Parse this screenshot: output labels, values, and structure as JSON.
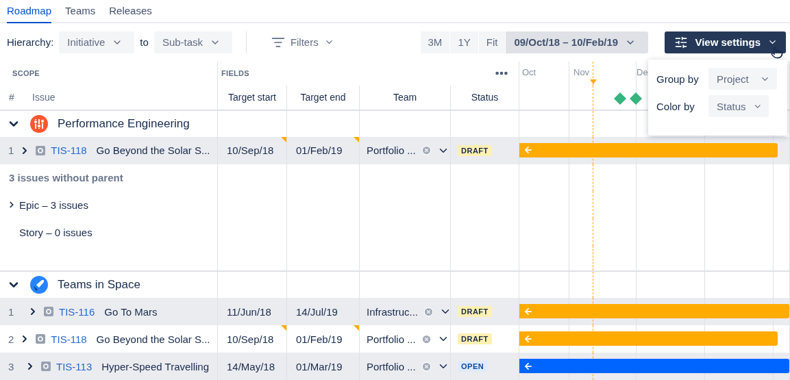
{
  "tabs": [
    {
      "label": "Roadmap",
      "selected": true
    },
    {
      "label": "Teams",
      "selected": false
    },
    {
      "label": "Releases",
      "selected": false
    }
  ],
  "toolbar": {
    "hierarchy_label": "Hierarchy:",
    "hierarchy_from": "Initiative",
    "to_label": "to",
    "hierarchy_to": "Sub-task",
    "filters": "Filters",
    "ranges": [
      {
        "label": "3M",
        "selected": false
      },
      {
        "label": "1Y",
        "selected": false
      },
      {
        "label": "Fit",
        "selected": false
      }
    ],
    "date_range": "09/Oct/18 – 10/Feb/19",
    "view_settings": "View settings"
  },
  "header": {
    "scope": "SCOPE",
    "fields": "FIELDS",
    "columns": [
      "#",
      "Issue",
      "Target start",
      "Target end",
      "Team",
      "Status"
    ],
    "months": [
      "Oct",
      "Nov",
      "De"
    ]
  },
  "view_settings_menu": [
    {
      "label": "Group by",
      "value": "Project"
    },
    {
      "label": "Color by",
      "value": "Status"
    }
  ],
  "groups": [
    {
      "name": "Performance Engineering",
      "expanded": true,
      "issues": [
        {
          "number": "1",
          "key": "TIS-118",
          "summary": "Go Beyond the Solar S...",
          "start": "10/Sep/18",
          "end": "01/Feb/19",
          "start_warning": true,
          "end_warning": true,
          "team": "Portfolio ...",
          "status": "DRAFT",
          "kind": "draft",
          "shaded": true,
          "bar_continues": false
        }
      ],
      "without_parent": {
        "label": "3 issues without parent",
        "types": [
          {
            "label": "Epic – 3 issues",
            "expandable": true
          },
          {
            "label": "Story – 0 issues",
            "expandable": false
          }
        ]
      }
    },
    {
      "name": "Teams in Space",
      "expanded": true,
      "issues": [
        {
          "number": "1",
          "key": "TIS-116",
          "summary": "Go To Mars",
          "start": "11/Jun/18",
          "end": "14/Jul/19",
          "start_warning": false,
          "end_warning": false,
          "team": "Infrastruc...",
          "status": "DRAFT",
          "kind": "draft",
          "shaded": true,
          "bar_continues": true
        },
        {
          "number": "2",
          "key": "TIS-118",
          "summary": "Go Beyond the Solar S...",
          "start": "10/Sep/18",
          "end": "01/Feb/19",
          "start_warning": true,
          "end_warning": true,
          "team": "Portfolio ...",
          "status": "DRAFT",
          "kind": "draft",
          "shaded": false,
          "bar_continues": false
        },
        {
          "number": "3",
          "key": "TIS-113",
          "summary": "Hyper-Speed Travelling",
          "start": "14/May/18",
          "end": "01/Mar/19",
          "start_warning": false,
          "end_warning": false,
          "team": "Portfolio ...",
          "status": "OPEN",
          "kind": "open",
          "shaded": true,
          "bar_continues": true
        }
      ]
    }
  ]
}
